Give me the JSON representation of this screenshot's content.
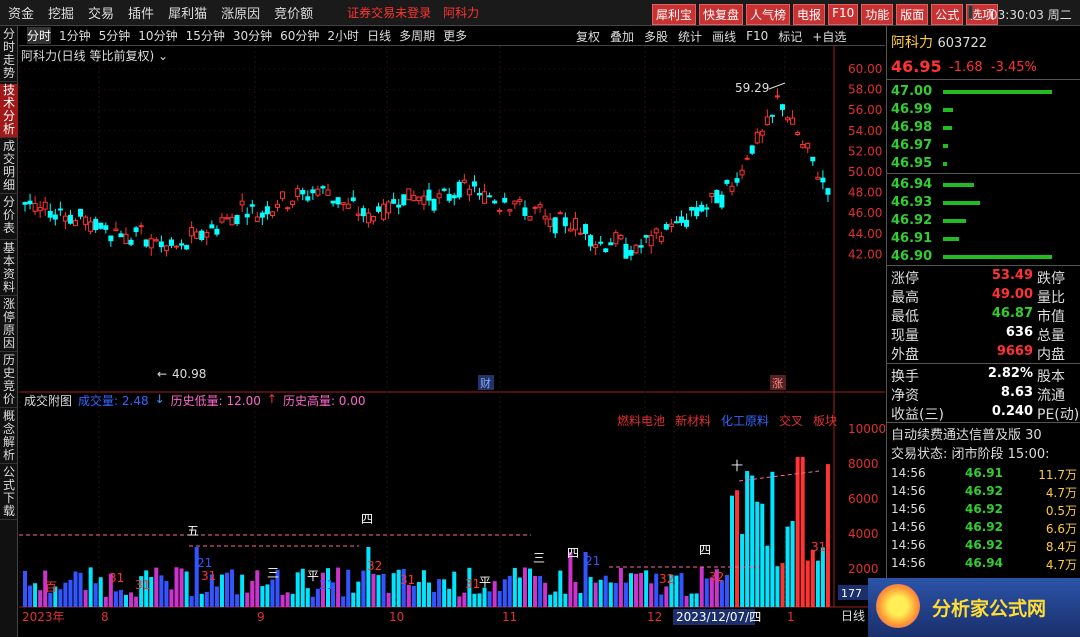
{
  "menu": {
    "items": [
      "资金",
      "挖掘",
      "交易",
      "插件",
      "犀利猫",
      "涨原因",
      "竞价额"
    ],
    "notice": "证券交易未登录",
    "stock": "阿科力",
    "buttons": [
      "犀利宝",
      "快复盘",
      "人气榜",
      "电报",
      "F10",
      "功能",
      "版面",
      "公式",
      "选项"
    ],
    "clock": "03:30:03 周二"
  },
  "sidetabs": [
    "分时走势",
    "技术分析",
    "成交明细",
    "分价表",
    "基本资料",
    "涨停原因",
    "历史竞价",
    "概念解析",
    "公式下载"
  ],
  "periods": [
    "分时",
    "1分钟",
    "5分钟",
    "10分钟",
    "15分钟",
    "30分钟",
    "60分钟",
    "2小时",
    "日线",
    "多周期",
    "更多"
  ],
  "period_actions": [
    "复权",
    "叠加",
    "多股",
    "统计",
    "画线",
    "F10",
    "标记",
    "+自选"
  ],
  "kline": {
    "title": "阿科力(日线 等比前复权)",
    "high_label": "59.29",
    "low_label": "40.98",
    "markers": [
      "财",
      "涨"
    ],
    "yaxis": [
      "60.00",
      "58.00",
      "56.00",
      "54.00",
      "52.00",
      "50.00",
      "48.00",
      "46.00",
      "44.00",
      "42.00"
    ]
  },
  "volume": {
    "title": "成交附图",
    "items": [
      {
        "label": "成交量: 2.48",
        "color": "#3366ff"
      },
      {
        "label": "↓",
        "color": "#3399ff"
      },
      {
        "label": "历史低量: 12.00",
        "color": "#ff66cc"
      },
      {
        "label": "↑",
        "color": "#ff3333"
      },
      {
        "label": "历史高量: 0.00",
        "color": "#ff66cc"
      }
    ],
    "tags": [
      "燃料电池",
      "新材料",
      "化工原料",
      "交叉",
      "板块"
    ],
    "yaxis": [
      "10000",
      "8000",
      "6000",
      "4000",
      "2000"
    ],
    "badge": "177",
    "period_label": "日线",
    "labels": [
      "五",
      "四",
      "三",
      "平",
      "三",
      "四",
      "平",
      "四",
      "十",
      "百",
      "21",
      "31",
      "31",
      "31",
      "21",
      "32",
      "31",
      "31",
      "32",
      "21",
      "32",
      "31"
    ]
  },
  "xaxis": [
    "2023年",
    "8",
    "9",
    "10",
    "11",
    "12",
    "2023/12/07/四",
    "1"
  ],
  "quote": {
    "name": "阿科力",
    "code": "603722",
    "price": "46.95",
    "chg": "-1.68",
    "pct": "-3.45%",
    "asks": [
      "47.00",
      "46.99",
      "46.98",
      "46.97",
      "46.95"
    ],
    "ask_bars": [
      0.95,
      0.06,
      0.05,
      0.02,
      0.01
    ],
    "bids": [
      "46.94",
      "46.93",
      "46.92",
      "46.91",
      "46.90"
    ],
    "bid_bars": [
      0.25,
      0.3,
      0.18,
      0.12,
      0.95
    ],
    "stats": [
      [
        "涨停",
        "53.49",
        "跌停"
      ],
      [
        "最高",
        "49.00",
        "量比"
      ],
      [
        "最低",
        "46.87",
        "市值"
      ],
      [
        "现量",
        "636",
        "总量"
      ],
      [
        "外盘",
        "9669",
        "内盘"
      ]
    ],
    "stats2": [
      [
        "换手",
        "2.82%",
        "股本"
      ],
      [
        "净资",
        "8.63",
        "流通"
      ],
      [
        "收益(三)",
        "0.240",
        "PE(动)"
      ]
    ],
    "ad": "自动续费通达信普及版 30",
    "trade_state": "交易状态: 闭市阶段 15:00:",
    "ticks": [
      [
        "14:56",
        "46.91",
        "11.7万"
      ],
      [
        "14:56",
        "46.92",
        "4.7万"
      ],
      [
        "14:56",
        "46.92",
        "0.5万"
      ],
      [
        "14:56",
        "46.92",
        "6.6万"
      ],
      [
        "14:56",
        "46.92",
        "8.4万"
      ],
      [
        "14:56",
        "46.94",
        "4.7万"
      ]
    ]
  },
  "logo": "分析家公式网"
}
